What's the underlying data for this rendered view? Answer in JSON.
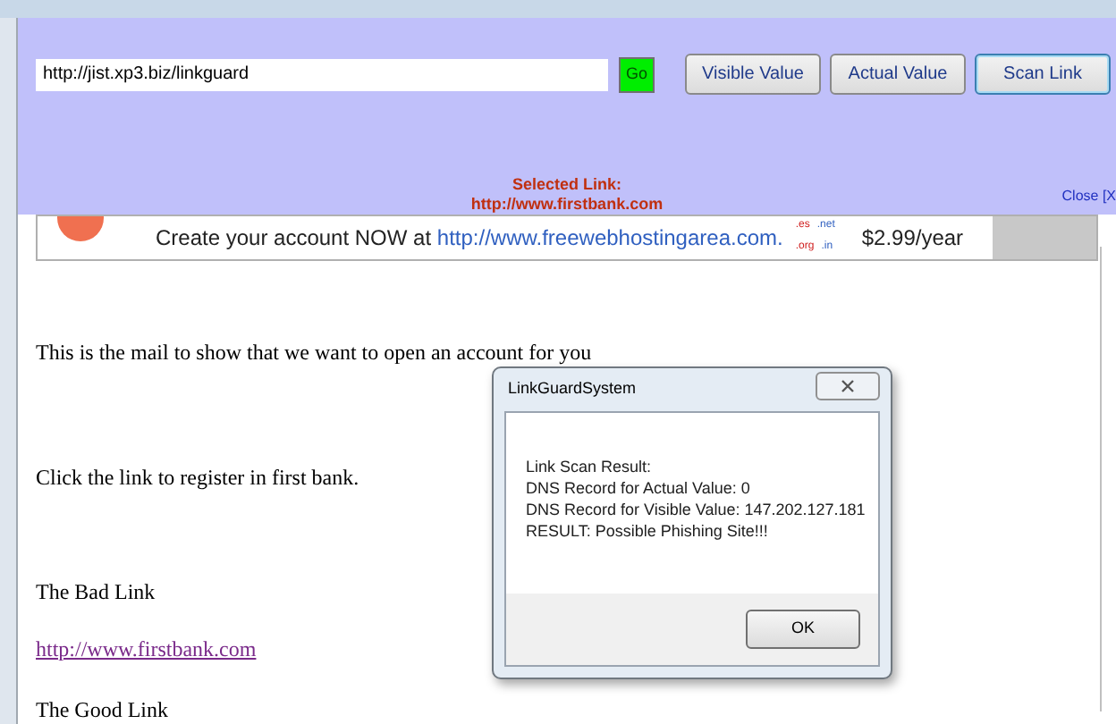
{
  "toolbar": {
    "url": "http://jist.xp3.biz/linkguard",
    "go": "Go",
    "buttons": [
      {
        "label": "Visible Value",
        "selected": false
      },
      {
        "label": "Actual Value",
        "selected": false
      },
      {
        "label": "Scan Link",
        "selected": true
      }
    ],
    "selected_label": "Selected Link:",
    "selected_url": "http://www.firstbank.com",
    "close": "Close [X"
  },
  "banner": {
    "text": "Create your account NOW at ",
    "link": "http://www.freewebhostingarea.com.",
    "domains": [
      ".es",
      ".net",
      ".org",
      ".in"
    ],
    "price": "$2.99/year"
  },
  "mail": [
    {
      "kind": "text",
      "text": "This is the mail to show that we want to open an account for you"
    },
    {
      "kind": "text",
      "text": "Click the link to register in first bank."
    },
    {
      "kind": "text",
      "text": "The Bad Link"
    },
    {
      "kind": "link",
      "text": "http://www.firstbank.com"
    },
    {
      "kind": "text",
      "text": "The Good Link"
    }
  ],
  "dialog": {
    "title": "LinkGuardSystem",
    "lines": [
      "Link Scan Result:",
      "DNS Record for Actual Value: 0",
      "DNS Record for Visible Value: 147.202.127.181",
      "RESULT: Possible Phishing Site!!!"
    ],
    "ok": "OK"
  }
}
